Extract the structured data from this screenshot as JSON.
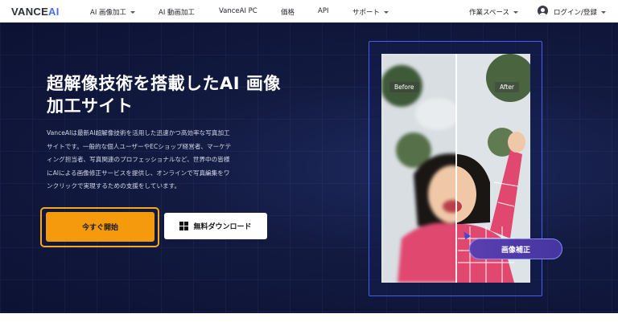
{
  "nav": {
    "logo": "VANCE",
    "logo_accent": "AI",
    "links": [
      "AI 画像加工",
      "AI 動画加工",
      "VanceAI PC",
      "価格",
      "API",
      "サポート"
    ],
    "workspace": "作業スペース",
    "login": "ログイン/登録"
  },
  "hero": {
    "title_line1": "超解像技術を搭載したAI 画像",
    "title_line2": "加工サイト",
    "description_lines": [
      "VanceAIは最新AI超解像技術を活用した迅速かつ高効率な写真加工",
      "サイトです。一般的な個人ユーザーやECショップ経営者、マーケテ",
      "ィング担当者、写真関連のプロフェッショナルなど、世界中の皆様",
      "にAIによる画像修正サービスを提供し、オンラインで写真編集をワ",
      "ンクリックで実現するための支援をしています。"
    ],
    "cta_label": "今すぐ開始",
    "download_label": "無料ダウンロード"
  },
  "preview": {
    "before_label": "Before",
    "after_label": "After",
    "enhance_label": "画像補正"
  },
  "colors": {
    "accent_orange": "#f59a0c",
    "hero_bg": "#121a40",
    "frame_blue": "#4a5cf0",
    "pill_purple": "#5a3fb0"
  }
}
